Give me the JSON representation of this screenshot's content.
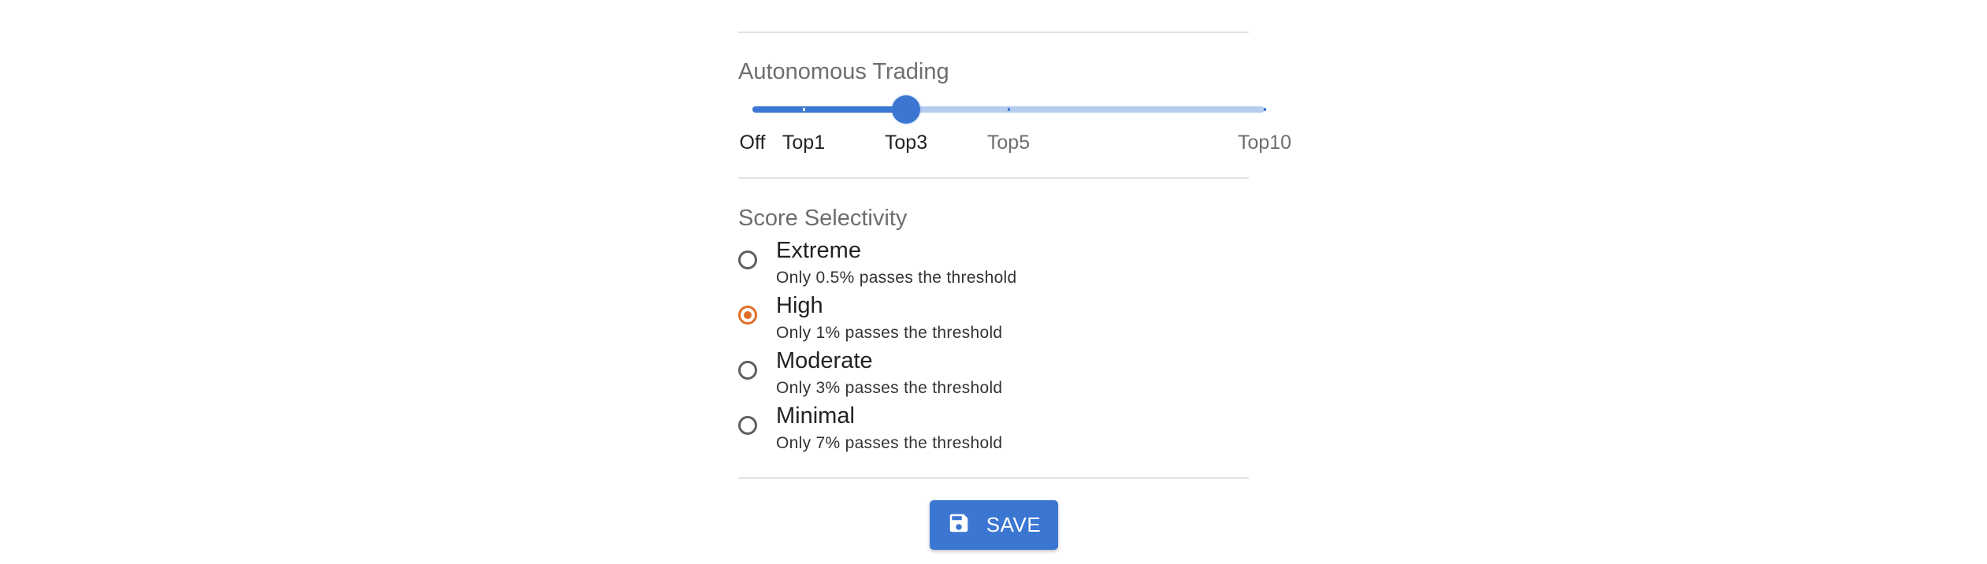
{
  "autonomous_trading": {
    "title": "Autonomous Trading",
    "value_fraction": 0.3,
    "marks": [
      {
        "label": "Off",
        "fraction": 0.0,
        "active": true
      },
      {
        "label": "Top1",
        "fraction": 0.1,
        "active": true
      },
      {
        "label": "Top3",
        "fraction": 0.3,
        "active": true
      },
      {
        "label": "Top5",
        "fraction": 0.5,
        "active": false
      },
      {
        "label": "Top10",
        "fraction": 1.0,
        "active": false
      }
    ]
  },
  "score_selectivity": {
    "title": "Score Selectivity",
    "selected": "High",
    "options": [
      {
        "label": "Extreme",
        "description": "Only 0.5% passes the threshold"
      },
      {
        "label": "High",
        "description": "Only 1% passes the threshold"
      },
      {
        "label": "Moderate",
        "description": "Only 3% passes the threshold"
      },
      {
        "label": "Minimal",
        "description": "Only 7% passes the threshold"
      }
    ]
  },
  "save_button": {
    "label": "SAVE",
    "icon": "floppy-disk-icon"
  },
  "colors": {
    "accent": "#3b77d2",
    "accent_light": "#b5cdee",
    "radio_checked": "#e06f25"
  }
}
